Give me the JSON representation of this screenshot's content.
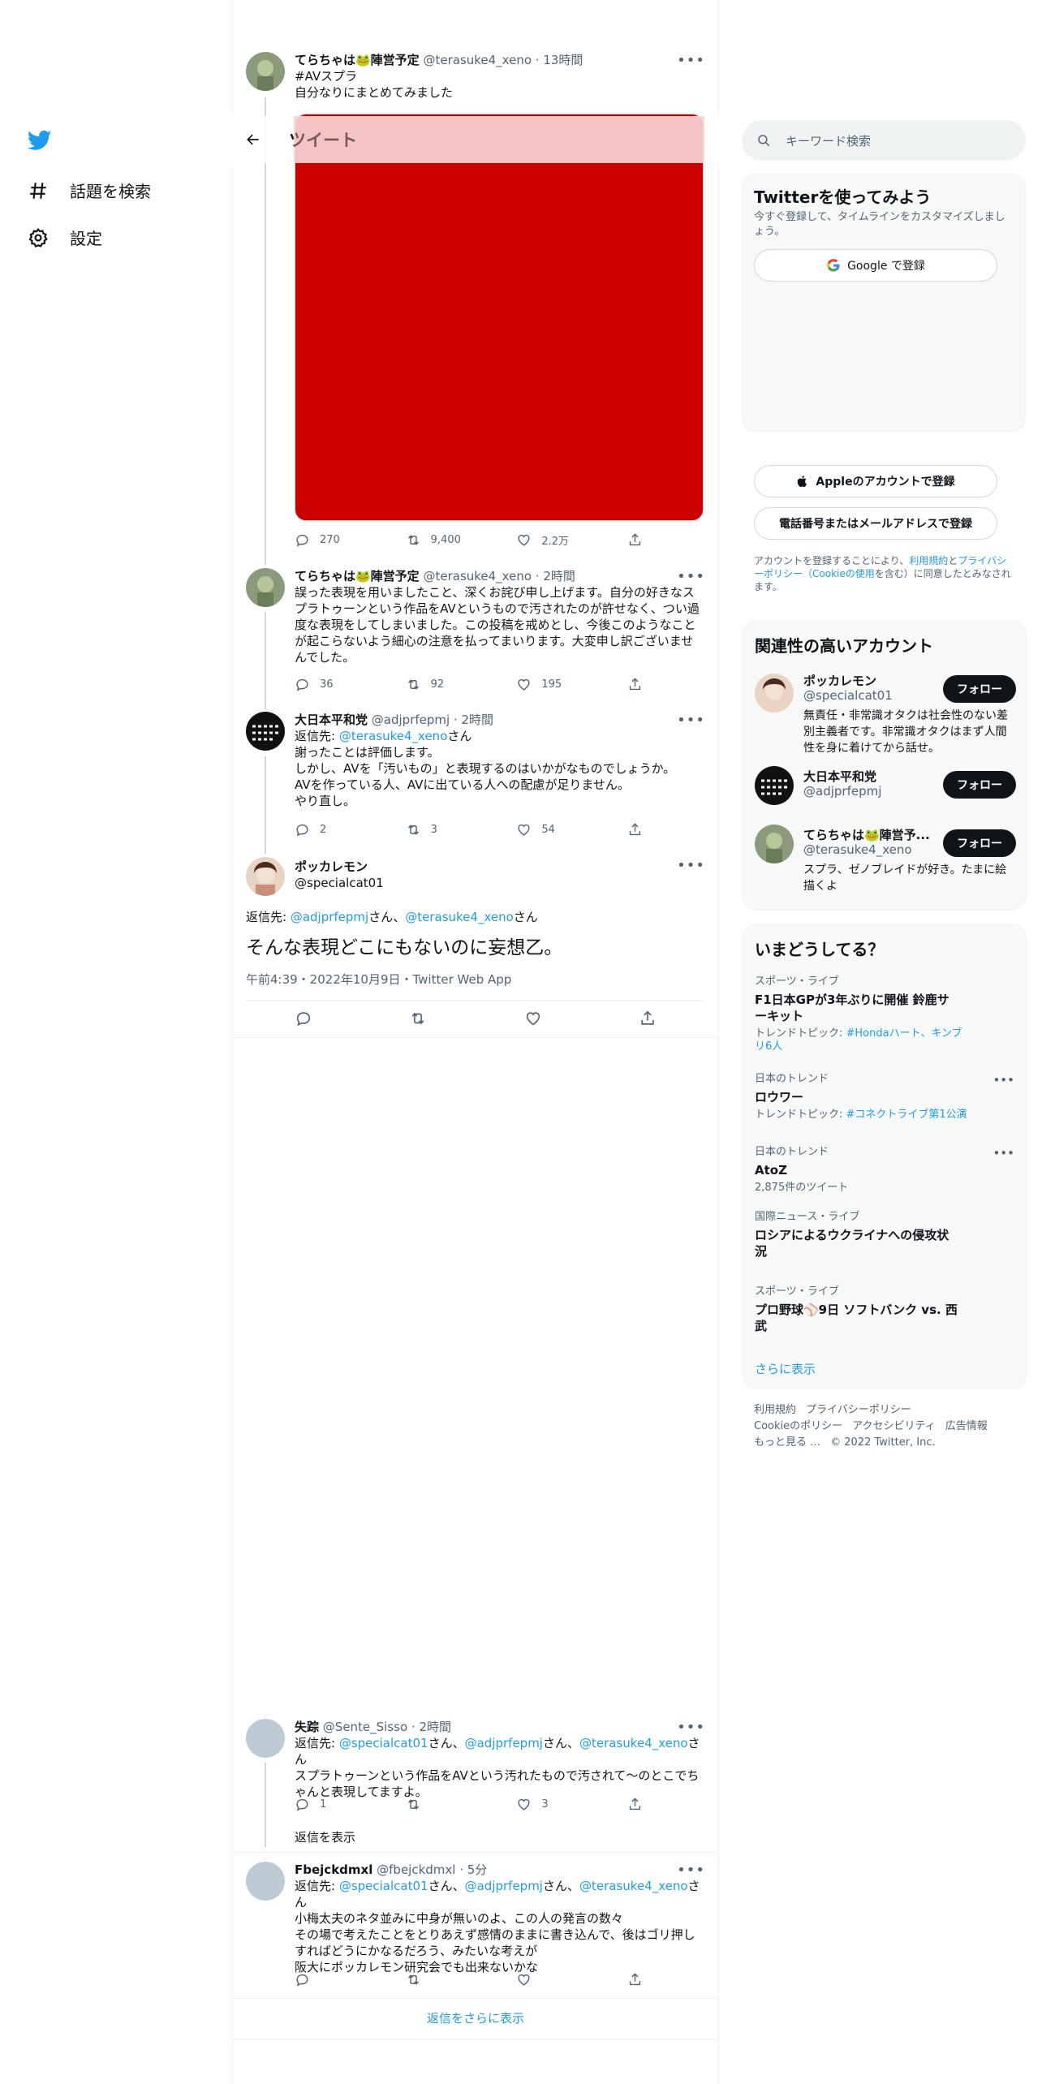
{
  "nav": {
    "items": [
      {
        "label": "話題を検索",
        "icon": "hashtag-icon"
      },
      {
        "label": "設定",
        "icon": "gear-icon"
      }
    ]
  },
  "header": {
    "title": "ツイート"
  },
  "tweets": [
    {
      "name": "てらちゃは🐸陣営予定",
      "handle": "@terasuke4_xeno",
      "time": "13時間",
      "hashtag": "#AVスプラ",
      "text": "自分なりにまとめてみました",
      "media_color": "#cc0000",
      "replies": "270",
      "retweets": "9,400",
      "likes": "2.2万"
    },
    {
      "name": "てらちゃは🐸陣営予定",
      "handle": "@terasuke4_xeno",
      "time": "2時間",
      "text_lines": [
        "誤った表現を用いましたこと、深くお詫び申し上げます。自分の好きなス",
        "プラトゥーンという作品をAVというもので汚されたのが許せなく、つい過",
        "度な表現をしてしまいました。この投稿を戒めとし、今後このようなこと",
        "が起こらないよう細心の注意を払ってまいります。大変申し訳ございませ",
        "んでした。"
      ],
      "replies": "36",
      "retweets": "92",
      "likes": "195"
    },
    {
      "name": "大日本平和党",
      "handle": "@adjprfepmj",
      "time": "2時間",
      "reply_prefix": "返信先: ",
      "reply_to": "@terasuke4_xeno",
      "reply_suffix": "さん",
      "text_lines": [
        "謝ったことは評価します。",
        "しかし、AVを「汚いもの」と表現するのはいかがなものでしょうか。",
        "AVを作っている人、AVに出ている人への配慮が足りません。",
        "やり直し。"
      ],
      "replies": "2",
      "retweets": "3",
      "likes": "54"
    }
  ],
  "focus": {
    "name": "ポッカレモン",
    "handle": "@specialcat01",
    "reply_prefix": "返信先: ",
    "reply_to_1": "@adjprfepmj",
    "reply_mid": "さん、",
    "reply_to_2": "@terasuke4_xeno",
    "reply_suffix": "さん",
    "text": "そんな表現どこにもないのに妄想乙。",
    "meta": "午前4:39・2022年10月9日・Twitter Web App"
  },
  "replies": [
    {
      "name": "失踪",
      "handle": "@Sente_Sisso",
      "time": "2時間",
      "reply_prefix": "返信先: ",
      "reply_to_1": "@specialcat01",
      "reply_to_2": "@adjprfepmj",
      "reply_to_3": "@terasuke4_xeno",
      "san": "さん",
      "san_sep": "さん、",
      "text_lines": [
        "スプラトゥーンという作品をAVという汚れたもので汚されて〜のとこでち",
        "ゃんと表現してますよ。"
      ],
      "replies": "1",
      "retweets": "",
      "likes": "3",
      "show_replies": "返信を表示"
    },
    {
      "name": "Fbejckdmxl",
      "handle": "@fbejckdmxl",
      "time": "5分",
      "reply_prefix": "返信先: ",
      "reply_to_1": "@specialcat01",
      "reply_to_2": "@adjprfepmj",
      "reply_to_3": "@terasuke4_xeno",
      "san": "さん",
      "san_sep": "さん、",
      "text_lines": [
        "小梅太夫のネタ並みに中身が無いのよ、この人の発言の数々",
        "その場で考えたことをとりあえず感情のままに書き込んで、後はゴリ押し",
        "すればどうにかなるだろう、みたいな考えが",
        "阪大にポッカレモン研究会でも出来ないかな"
      ],
      "replies": "",
      "retweets": "",
      "likes": ""
    }
  ],
  "more_replies": "返信をさらに表示",
  "search": {
    "placeholder": "キーワード検索"
  },
  "signup": {
    "title": "Twitterを使ってみよう",
    "desc": "今すぐ登録して、タイムラインをカスタマイズしましょう。",
    "google": "Google で登録",
    "apple": "Appleのアカウントで登録",
    "phone": "電話番号またはメールアドレスで登録",
    "legal_1": "アカウントを登録することにより、",
    "legal_tos": "利用規約",
    "legal_2": "と",
    "legal_pp": "プライバシーポリシー（Cookieの使用",
    "legal_3": "を含む）に同意したとみなされます。"
  },
  "related": {
    "title": "関連性の高いアカウント",
    "accounts": [
      {
        "name": "ポッカレモン",
        "handle": "@specialcat01",
        "bio": "無責任・非常識オタクは社会性のない差別主義者です。非常識オタクはまず人間性を身に着けてから話せ。",
        "follow": "フォロー"
      },
      {
        "name": "大日本平和党",
        "handle": "@adjprfepmj",
        "bio": "",
        "follow": "フォロー"
      },
      {
        "name": "てらちゃは🐸陣営予...",
        "handle": "@terasuke4_xeno",
        "bio": "スプラ、ゼノブレイドが好き。たまに絵描くよ",
        "follow": "フォロー"
      }
    ]
  },
  "trends": {
    "title": "いまどうしてる？",
    "items": [
      {
        "cat": "スポーツ・ライブ",
        "name": "F1日本GPが3年ぶりに開催 鈴鹿サーキット",
        "sub_prefix": "トレンドトピック: ",
        "sub_link": "#Hondaハート、キンブリ6人"
      },
      {
        "cat": "日本のトレンド",
        "name": "ロウワー",
        "sub_prefix": "トレンドトピック: ",
        "sub_link": "#コネクトライブ第1公演"
      },
      {
        "cat": "日本のトレンド",
        "name": "AtoZ",
        "sub_prefix": "2,875件のツイート",
        "sub_link": ""
      },
      {
        "cat": "国際ニュース・ライブ",
        "name": "ロシアによるウクライナへの侵攻状況",
        "sub_prefix": "",
        "sub_link": ""
      },
      {
        "cat": "スポーツ・ライブ",
        "name": "プロ野球⚾9日 ソフトバンク vs. 西武",
        "sub_prefix": "",
        "sub_link": ""
      }
    ],
    "show_more": "さらに表示"
  },
  "footer": {
    "terms": "利用規約",
    "privacy": "プライバシーポリシー",
    "cookie": "Cookieのポリシー",
    "access": "アクセシビリティ",
    "ads": "広告情報",
    "more": "もっと見る …",
    "copy": "© 2022 Twitter, Inc."
  }
}
